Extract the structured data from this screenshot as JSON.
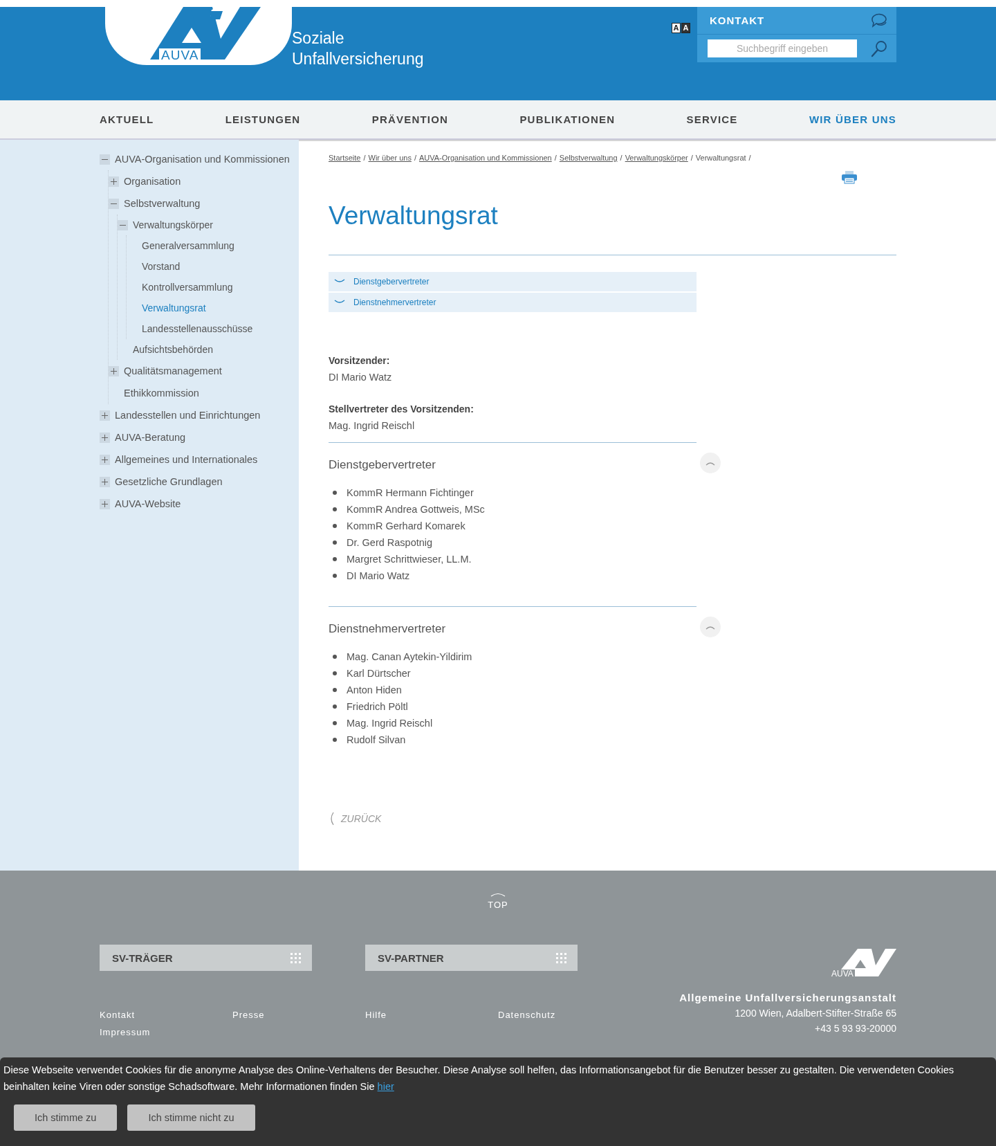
{
  "header": {
    "logo_text": "AUVA",
    "tagline": [
      "Soziale",
      "Unfallversicherung"
    ],
    "font_toggle": [
      "A",
      "A"
    ],
    "contact": "KONTAKT",
    "search": {
      "placeholder": "Suchbegriff eingeben"
    }
  },
  "nav": [
    {
      "label": "AKTUELL",
      "selected": false
    },
    {
      "label": "LEISTUNGEN",
      "selected": false
    },
    {
      "label": "PRÄVENTION",
      "selected": false
    },
    {
      "label": "PUBLIKATIONEN",
      "selected": false
    },
    {
      "label": "SERVICE",
      "selected": false
    },
    {
      "label": "WIR ÜBER UNS",
      "selected": true
    }
  ],
  "sidebar": {
    "items": [
      {
        "label": "AUVA-Organisation und Kommissionen",
        "kind": "branch",
        "expanded": true,
        "selected": false,
        "children": [
          {
            "label": "Organisation",
            "kind": "branch",
            "expanded": false,
            "selected": false
          },
          {
            "label": "Selbstverwaltung",
            "kind": "branch",
            "expanded": true,
            "selected": false,
            "children": [
              {
                "label": "Verwaltungskörper",
                "kind": "branch",
                "expanded": true,
                "selected": false,
                "children": [
                  {
                    "label": "Generalversammlung",
                    "kind": "leaf",
                    "selected": false
                  },
                  {
                    "label": "Vorstand",
                    "kind": "leaf",
                    "selected": false
                  },
                  {
                    "label": "Kontrollversammlung",
                    "kind": "leaf",
                    "selected": false
                  },
                  {
                    "label": "Verwaltungsrat",
                    "kind": "leaf",
                    "selected": true
                  },
                  {
                    "label": "Landesstellenausschüsse",
                    "kind": "leaf",
                    "selected": false
                  }
                ]
              },
              {
                "label": "Aufsichtsbehörden",
                "kind": "leaf",
                "selected": false
              }
            ]
          },
          {
            "label": "Qualitätsmanagement",
            "kind": "branch",
            "expanded": false,
            "selected": false
          },
          {
            "label": "Ethikkommission",
            "kind": "leaf",
            "selected": false
          }
        ]
      },
      {
        "label": "Landesstellen und Einrichtungen",
        "kind": "branch",
        "expanded": false,
        "selected": false
      },
      {
        "label": "AUVA-Beratung",
        "kind": "branch",
        "expanded": false,
        "selected": false
      },
      {
        "label": "Allgemeines und Internationales",
        "kind": "branch",
        "expanded": false,
        "selected": false
      },
      {
        "label": "Gesetzliche Grundlagen",
        "kind": "branch",
        "expanded": false,
        "selected": false
      },
      {
        "label": "AUVA-Website",
        "kind": "branch",
        "expanded": false,
        "selected": false
      }
    ]
  },
  "breadcrumb": {
    "separator": "/",
    "items": [
      {
        "label": "Startseite",
        "kind": "link"
      },
      {
        "label": "Wir über uns",
        "kind": "link"
      },
      {
        "label": "AUVA-Organisation und Kommissionen",
        "kind": "link"
      },
      {
        "label": "Selbstverwaltung",
        "kind": "link"
      },
      {
        "label": "Verwaltungskörper",
        "kind": "link"
      },
      {
        "label": "Verwaltungsrat",
        "kind": "current"
      }
    ]
  },
  "title": "Verwaltungsrat",
  "accordion": [
    {
      "label": "Dienstgebervertreter",
      "expanded": false
    },
    {
      "label": "Dienstnehmervertreter",
      "expanded": false
    }
  ],
  "roles": [
    {
      "label": "Vorsitzender:",
      "name": "DI Mario Watz"
    },
    {
      "label": "Stellvertreter des Vorsitzenden:",
      "name": "Mag. Ingrid Reischl"
    }
  ],
  "sections": [
    {
      "heading": "Dienstgebervertreter",
      "members": [
        "KommR Hermann Fichtinger",
        "KommR Andrea Gottweis, MSc",
        "KommR Gerhard Komarek",
        "Dr. Gerd Raspotnig",
        "Margret Schrittwieser, LL.M.",
        "DI Mario Watz"
      ]
    },
    {
      "heading": "Dienstnehmervertreter",
      "members": [
        "Mag. Canan Aytekin-Yildirim",
        "Karl Dürtscher",
        "Anton Hiden",
        "Friedrich Pöltl",
        "Mag. Ingrid Reischl",
        "Rudolf Silvan"
      ]
    }
  ],
  "back": "ZURÜCK",
  "footer": {
    "top": "TOP",
    "boxes": [
      "SV-TRÄGER",
      "SV-PARTNER"
    ],
    "links": [
      "Kontakt",
      "Presse",
      "Hilfe",
      "Datenschutz",
      "Impressum"
    ],
    "logo_text": "AUVA",
    "org": "Allgemeine Unfallversicherungsanstalt",
    "address": [
      "1200 Wien, Adalbert-Stifter-Straße 65",
      "+43 5 93 93-20000"
    ]
  },
  "cookie": {
    "text": "Diese Webseite verwendet Cookies für die anonyme Analyse des Online-Verhaltens der Besucher. Diese Analyse soll helfen, das Informationsangebot für die Benutzer besser zu gestalten. Die verwendeten Cookies beinhalten keine Viren oder sonstige Schadsoftware. Mehr Informationen finden Sie",
    "link": "hier",
    "buttons": [
      "Ich stimme zu",
      "Ich stimme nicht zu"
    ]
  }
}
